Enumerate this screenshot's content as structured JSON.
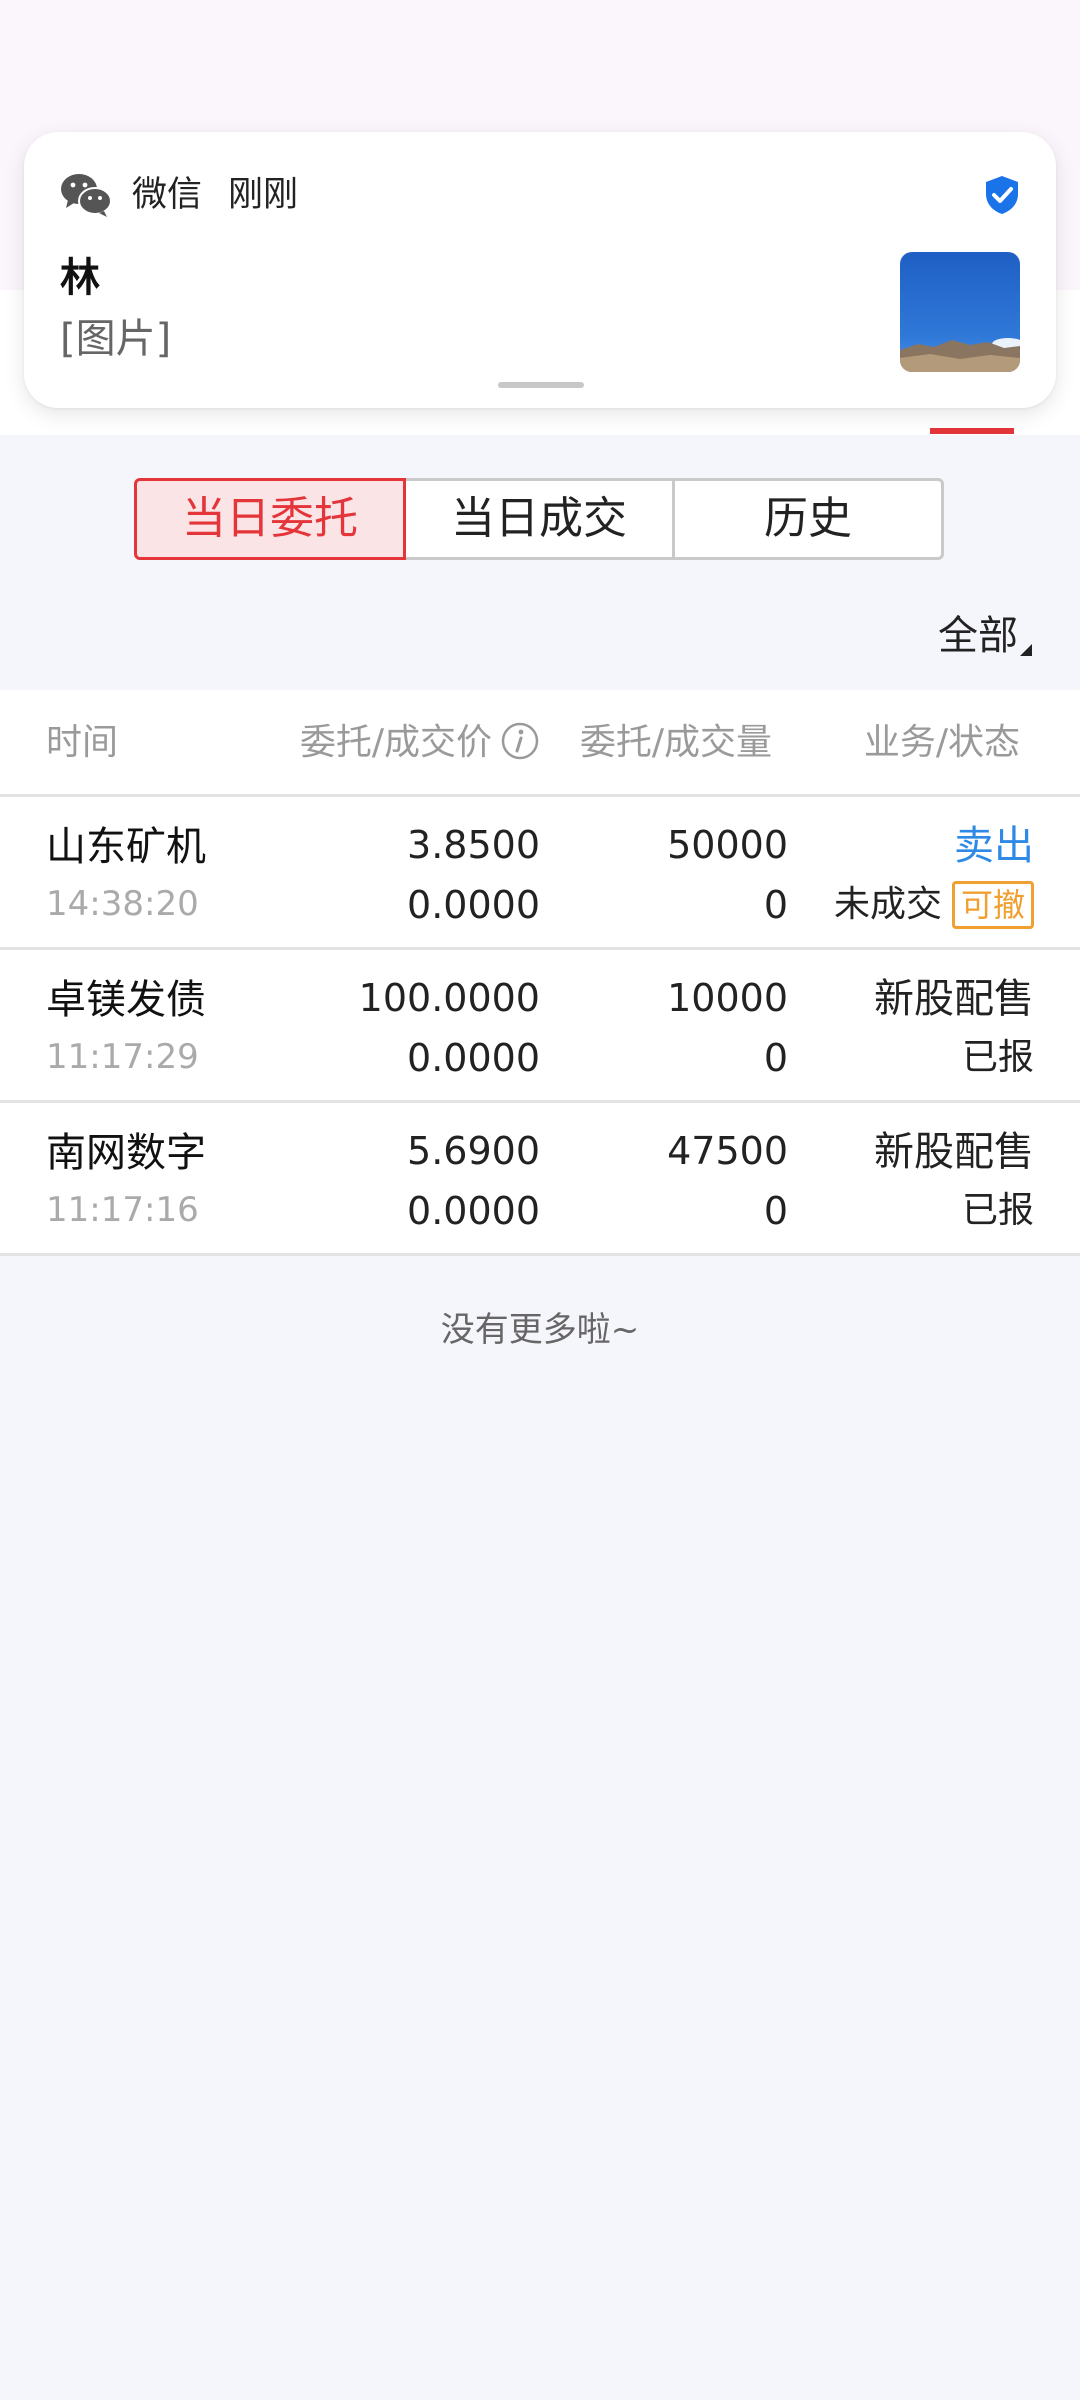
{
  "notification": {
    "app_name": "微信",
    "time": "刚刚",
    "sender": "林",
    "message": "[图片]",
    "icons": {
      "app": "wechat-icon",
      "verified": "shield-check-icon",
      "thumbnail": "image-thumbnail"
    },
    "colors": {
      "shield": "#1a73e8"
    }
  },
  "tabs": [
    {
      "label": "当日委托",
      "active": true
    },
    {
      "label": "当日成交",
      "active": false
    },
    {
      "label": "历史",
      "active": false
    }
  ],
  "filter": {
    "label": "全部"
  },
  "table": {
    "headers": {
      "time": "时间",
      "price": "委托/成交价",
      "quantity": "委托/成交量",
      "status": "业务/状态"
    },
    "rows": [
      {
        "name": "山东矿机",
        "time": "14:38:20",
        "order_price": "3.8500",
        "deal_price": "0.0000",
        "order_qty": "50000",
        "deal_qty": "0",
        "business": "卖出",
        "status": "未成交",
        "badge": "可撤"
      },
      {
        "name": "卓镁发债",
        "time": "11:17:29",
        "order_price": "100.0000",
        "deal_price": "0.0000",
        "order_qty": "10000",
        "deal_qty": "0",
        "business": "新股配售",
        "status": "已报"
      },
      {
        "name": "南网数字",
        "time": "11:17:16",
        "order_price": "5.6900",
        "deal_price": "0.0000",
        "order_qty": "47500",
        "deal_qty": "0",
        "business": "新股配售",
        "status": "已报"
      }
    ]
  },
  "footer": {
    "no_more": "没有更多啦~"
  },
  "colors": {
    "accent_red": "#e3353a",
    "sell_blue": "#2f8ae6",
    "badge_orange": "#f0a030"
  }
}
